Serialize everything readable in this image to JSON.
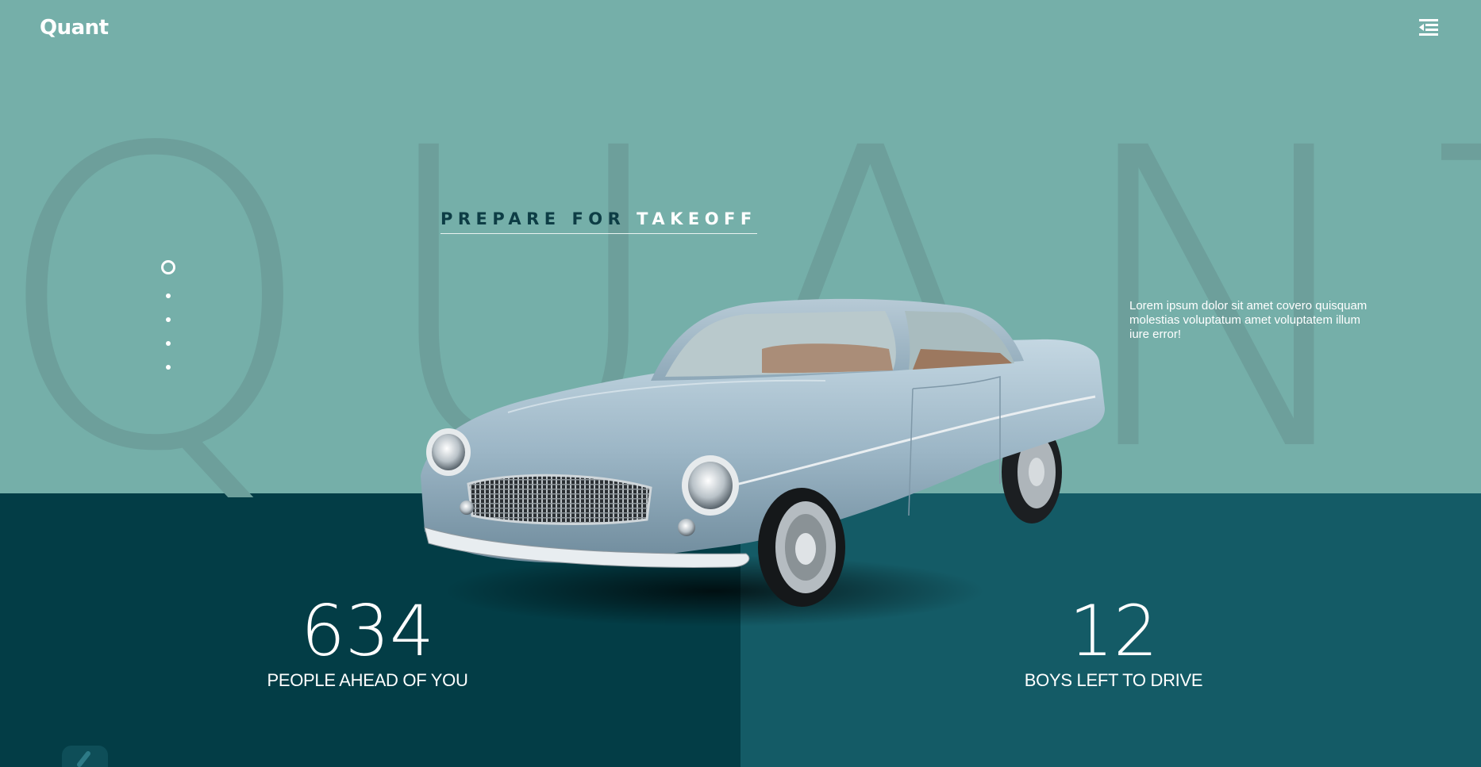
{
  "brand": {
    "logo": "Quant",
    "bg_word": "QUANT"
  },
  "nav": {
    "menu_icon": "menu-icon"
  },
  "hero": {
    "tagline_dark": "PREPARE FOR",
    "tagline_light": "TAKEOFF",
    "description": "Lorem ipsum dolor sit amet covero quisquam molestias voluptatum amet voluptatem illum iure error!"
  },
  "slider": {
    "total": 5,
    "active": 1
  },
  "stats": [
    {
      "value": "634",
      "label": "PEOPLE AHEAD OF YOU"
    },
    {
      "value": "12",
      "label": "BOYS LEFT TO DRIVE"
    }
  ],
  "colors": {
    "top_bg": "#75afa9",
    "left_panel": "#033d46",
    "right_panel": "#145b66",
    "car_body": "#9fb8c8"
  },
  "icons": {
    "back": "chevron-left-icon",
    "car": "classic-car-image"
  }
}
